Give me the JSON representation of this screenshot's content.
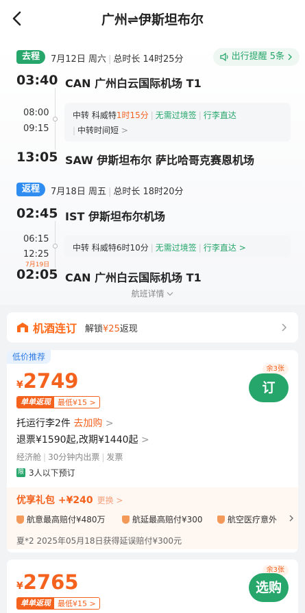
{
  "header": {
    "title": "广州⇌伊斯坦布尔"
  },
  "outbound": {
    "tag": "去程",
    "date": "7月12日 周六",
    "duration": "总时长 14时25分",
    "remind": "出行提醒 5条",
    "dep_time": "03:40",
    "dep_airport": "CAN 广州白云国际机场 T1",
    "arr_mid": "08:00",
    "dep_mid": "09:15",
    "transfer_label": "中转 科威特",
    "transfer_time": "1时15分",
    "no_visa": "无需过境签",
    "baggage": "行李直达",
    "short_note": "中转时间短",
    "arr_time": "13:05",
    "arr_airport": "SAW 伊斯坦布尔 萨比哈哥克赛恩机场"
  },
  "return": {
    "tag": "返程",
    "date": "7月18日 周五",
    "duration": "总时长 18时20分",
    "dep_time": "02:45",
    "dep_airport": "IST 伊斯坦布尔机场",
    "arr_mid": "06:15",
    "dep_mid": "12:25",
    "transfer_text": "中转 科威特6时10分",
    "no_visa": "无需过境签",
    "baggage": "行李直达",
    "next_day": "7月19日",
    "arr_time": "02:05",
    "arr_airport": "CAN 广州白云国际机场 T1"
  },
  "details_label": "航班详情",
  "hotel": {
    "brand": "机酒连订",
    "text_prefix": "解锁",
    "amount": "¥25",
    "text_suffix": "返现"
  },
  "offer1": {
    "tag": "低价推荐",
    "currency": "¥",
    "price": "2749",
    "rebate_a": "单单返现",
    "rebate_b": "最低¥15",
    "remain": "余3张",
    "book": "订",
    "baggage": "托运行李2件",
    "add_buy": "去加购",
    "refund": "退票¥1590起,改期¥1440起",
    "cabin": "经济舱",
    "issue": "30分钟内出票",
    "invoice": "发票",
    "limit_icon": "限",
    "limit": "3人以下预订",
    "gift_title": "优享礼包 +¥240",
    "gift_change": "更换",
    "ins1": "航意最高赔付¥480万",
    "ins2": "航延最高赔付¥300",
    "ins3": "航空医疗意外",
    "gift_foot": "夏*2 2025年05月18日获得延误赔付¥300元"
  },
  "offer2": {
    "currency": "¥",
    "price": "2765",
    "rebate_a": "单单返现",
    "rebate_b": "最低¥15",
    "remain": "余3张",
    "book": "选购"
  },
  "colors": {
    "accent": "#f5621e",
    "green": "#26a66b",
    "blue": "#2f8cf0"
  }
}
